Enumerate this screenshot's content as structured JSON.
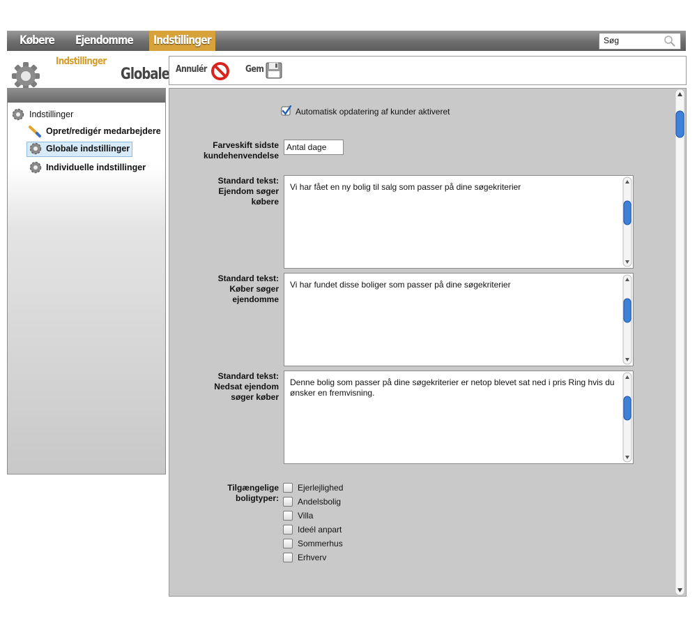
{
  "nav": {
    "tabs": [
      {
        "label": "Købere",
        "active": false
      },
      {
        "label": "Ejendomme",
        "active": false
      },
      {
        "label": "Indstillinger",
        "active": true
      }
    ],
    "search_placeholder": "Søg"
  },
  "header": {
    "section": "Indstillinger",
    "title": "Globale"
  },
  "toolbar": {
    "cancel_label": "Annulér",
    "save_label": "Gem"
  },
  "sidebar": {
    "root": "Indstillinger",
    "items": [
      {
        "label": "Opret/redigér medarbejdere",
        "icon": "pencil-icon",
        "selected": false
      },
      {
        "label": "Globale indstillinger",
        "icon": "gear-icon",
        "selected": true
      },
      {
        "label": "Individuelle indstillinger",
        "icon": "gear-icon",
        "selected": false
      }
    ]
  },
  "form": {
    "auto_update": {
      "label": "Automatisk opdatering af kunder aktiveret",
      "checked": true
    },
    "color_change": {
      "label_line1": "Farveskift sidste",
      "label_line2": "kundehenvendelse",
      "value": "Antal dage"
    },
    "texts": [
      {
        "label_line1": "Standard tekst:",
        "label_line2": "Ejendom søger",
        "label_line3": "købere",
        "value": "Vi har fået en ny bolig til salg som passer på dine søgekriterier"
      },
      {
        "label_line1": "Standard tekst:",
        "label_line2": "Køber søger",
        "label_line3": "ejendomme",
        "value": "Vi har fundet disse boliger som passer på dine søgekriterier"
      },
      {
        "label_line1": "Standard tekst:",
        "label_line2": "Nedsat ejendom",
        "label_line3": "søger køber",
        "value": "Denne bolig som passer på dine søgekriterier er netop blevet sat ned i pris Ring hvis du ønsker en fremvisning."
      }
    ],
    "property_types": {
      "label_line1": "Tilgængelige",
      "label_line2": "boligtyper:",
      "options": [
        {
          "label": "Ejerlejlighed",
          "checked": false
        },
        {
          "label": "Andelsbolig",
          "checked": false
        },
        {
          "label": "Villa",
          "checked": false
        },
        {
          "label": "Ideél anpart",
          "checked": false
        },
        {
          "label": "Sommerhus",
          "checked": false
        },
        {
          "label": "Erhverv",
          "checked": false
        }
      ]
    }
  },
  "colors": {
    "accent": "#d7a23a",
    "nav_bg": "#777777",
    "panel_bg": "#c9c9c9",
    "selected_bg": "#d6eaf8",
    "check_blue": "#1f5fb8",
    "cancel_red": "#d9241e"
  }
}
